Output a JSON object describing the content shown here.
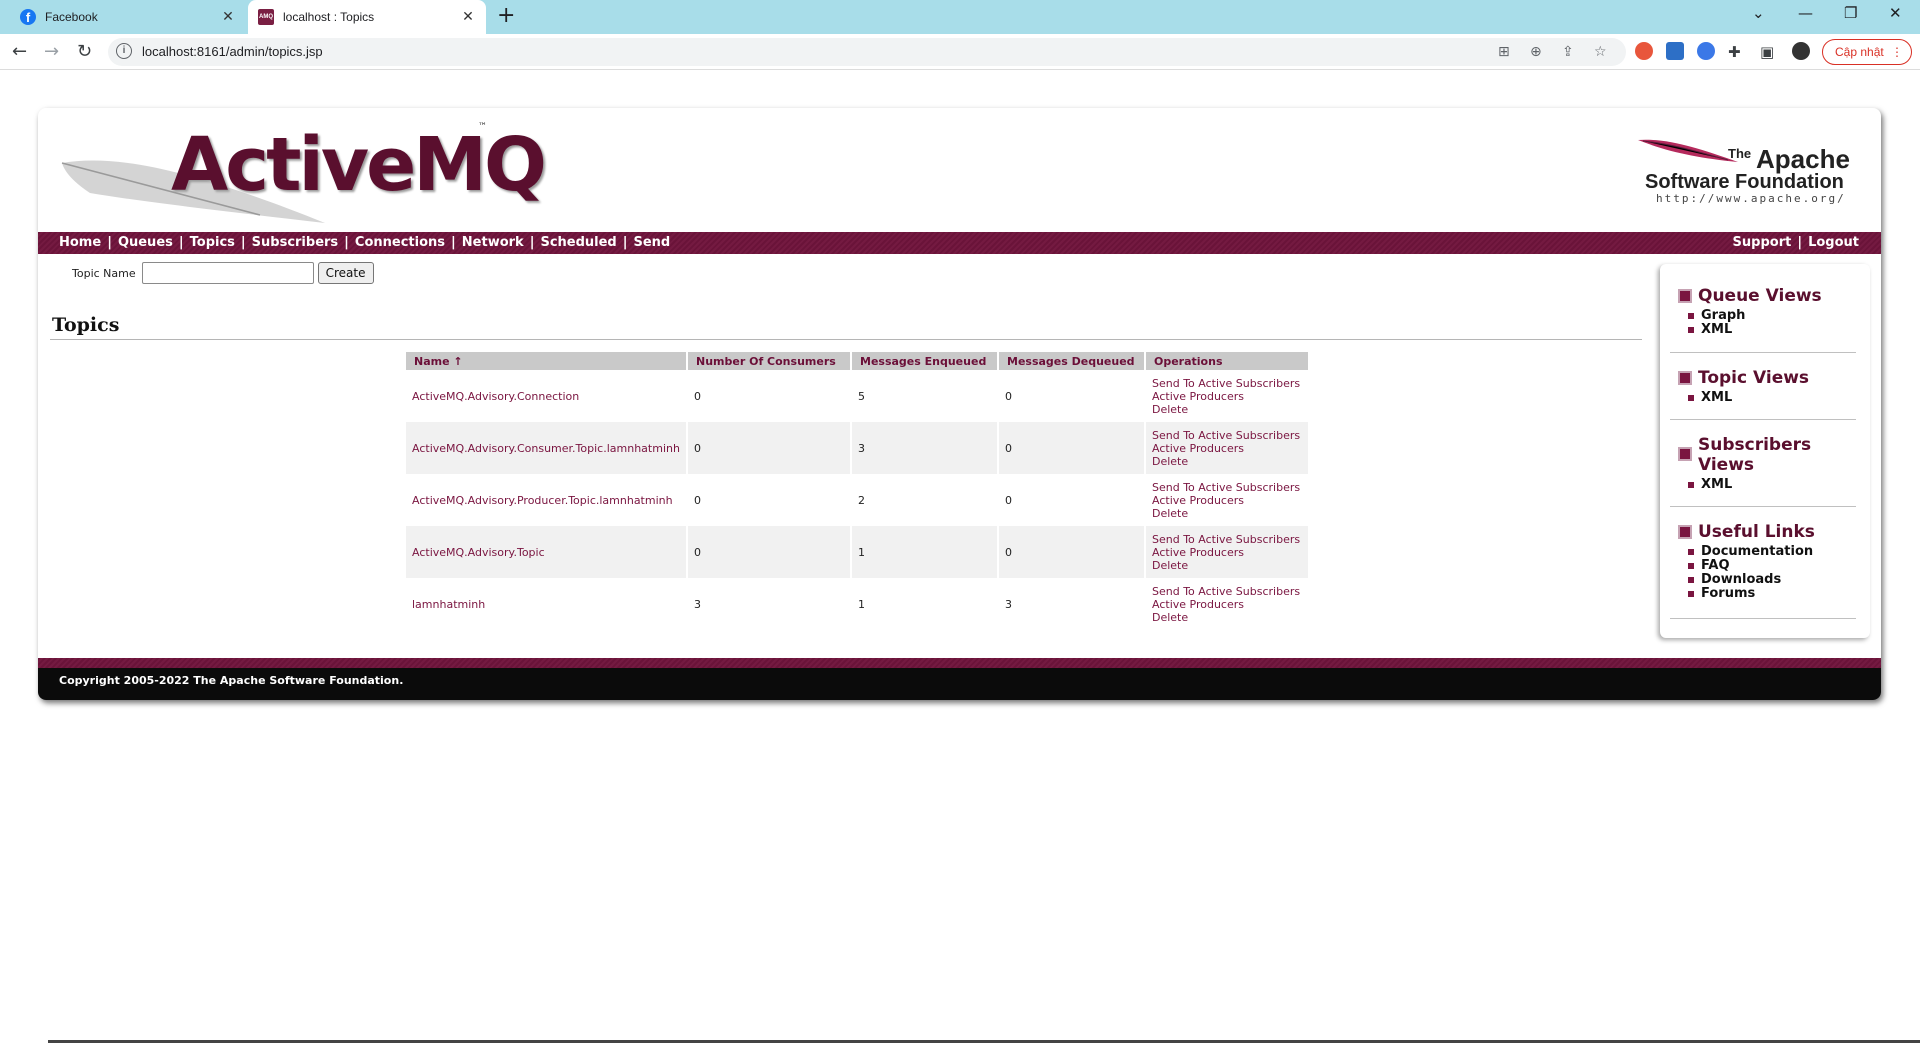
{
  "browser": {
    "tabs": [
      {
        "title": "Facebook",
        "icon": "facebook-icon"
      },
      {
        "title": "localhost : Topics",
        "icon": "activemq-icon",
        "favicon_text": "AMQ"
      }
    ],
    "url": "localhost:8161/admin/topics.jsp",
    "update_label": "Cập nhật"
  },
  "page": {
    "logo": "ActiveMQ",
    "logo_tm": "™",
    "asf": {
      "the": "The",
      "apache": "Apache",
      "sf": "Software Foundation",
      "url": "http://www.apache.org/"
    },
    "nav": [
      "Home",
      "Queues",
      "Topics",
      "Subscribers",
      "Connections",
      "Network",
      "Scheduled",
      "Send"
    ],
    "nav_right": [
      "Support",
      "Logout"
    ],
    "create": {
      "label": "Topic Name",
      "value": "",
      "button": "Create"
    },
    "title": "Topics",
    "table": {
      "headers": [
        "Name ↑",
        "Number Of Consumers",
        "Messages Enqueued",
        "Messages Dequeued",
        "Operations"
      ],
      "operations": [
        "Send To Active Subscribers",
        "Active Producers",
        "Delete"
      ],
      "rows": [
        {
          "name": "ActiveMQ.Advisory.Connection",
          "consumers": "0",
          "enqueued": "5",
          "dequeued": "0"
        },
        {
          "name": "ActiveMQ.Advisory.Consumer.Topic.lamnhatminh",
          "consumers": "0",
          "enqueued": "3",
          "dequeued": "0"
        },
        {
          "name": "ActiveMQ.Advisory.Producer.Topic.lamnhatminh",
          "consumers": "0",
          "enqueued": "2",
          "dequeued": "0"
        },
        {
          "name": "ActiveMQ.Advisory.Topic",
          "consumers": "0",
          "enqueued": "1",
          "dequeued": "0"
        },
        {
          "name": "lamnhatminh",
          "consumers": "3",
          "enqueued": "1",
          "dequeued": "3"
        }
      ]
    },
    "sidebar": {
      "queue_views": {
        "title": "Queue Views",
        "items": [
          "Graph",
          "XML"
        ]
      },
      "topic_views": {
        "title": "Topic Views",
        "items": [
          "XML"
        ]
      },
      "subscribers_views": {
        "title": "Subscribers Views",
        "items": [
          "XML"
        ]
      },
      "useful_links": {
        "title": "Useful Links",
        "items": [
          "Documentation",
          "FAQ",
          "Downloads",
          "Forums"
        ]
      }
    },
    "footer": "Copyright 2005-2022 The Apache Software Foundation."
  },
  "colors": {
    "tabbar": "#a8dde9",
    "brand": "#6a1339",
    "link": "#7a1540"
  }
}
